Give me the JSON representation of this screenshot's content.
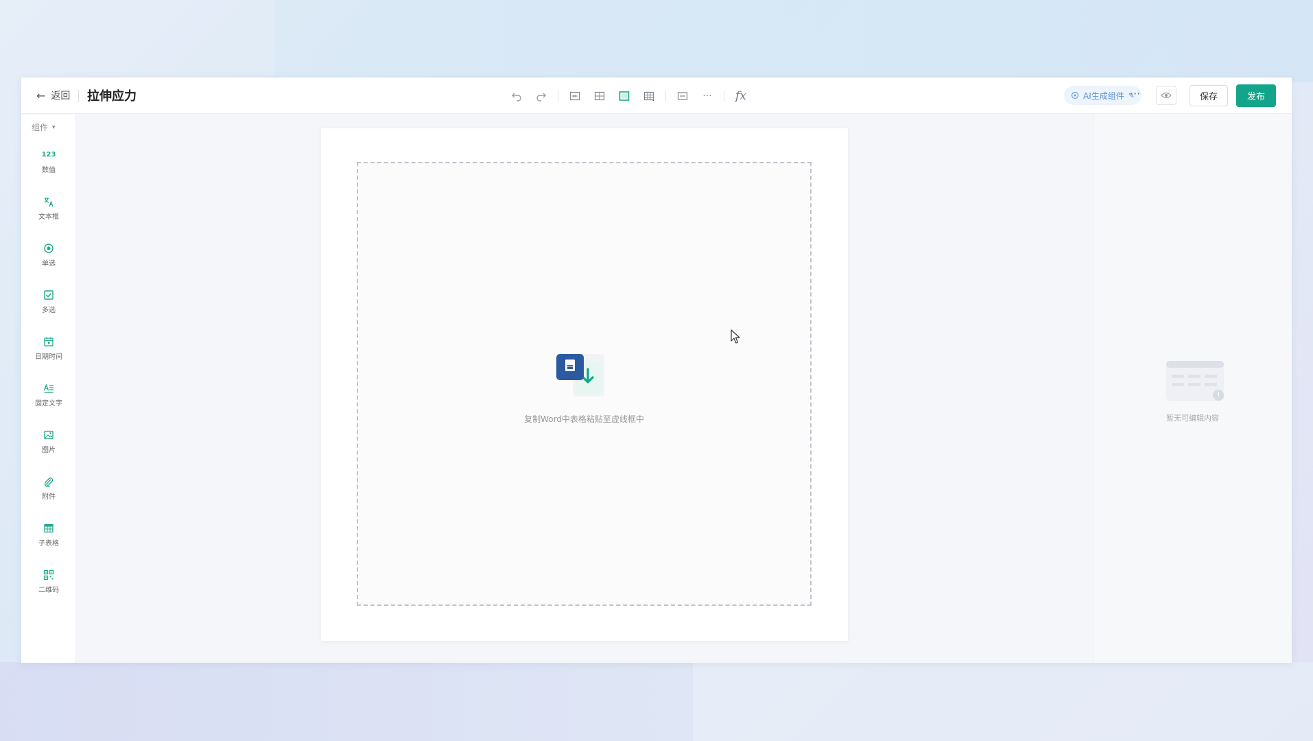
{
  "header": {
    "back_label": "返回",
    "title": "拉伸应力",
    "ai_label": "AI生成组件",
    "more_label": "···",
    "save_label": "保存",
    "publish_label": "发布",
    "fx_label": "fx"
  },
  "palette": {
    "title": "组件",
    "items": [
      {
        "label": "数值",
        "icon": "number-icon",
        "glyph": "123"
      },
      {
        "label": "文本框",
        "icon": "text-translate-icon"
      },
      {
        "label": "单选",
        "icon": "radio-icon"
      },
      {
        "label": "多选",
        "icon": "checkbox-icon"
      },
      {
        "label": "日期时间",
        "icon": "calendar-icon"
      },
      {
        "label": "固定文字",
        "icon": "fixed-text-icon"
      },
      {
        "label": "图片",
        "icon": "image-icon"
      },
      {
        "label": "附件",
        "icon": "paperclip-icon"
      },
      {
        "label": "子表格",
        "icon": "subtable-icon"
      },
      {
        "label": "二维码",
        "icon": "qrcode-icon"
      }
    ]
  },
  "canvas": {
    "drop_hint": "复制Word中表格粘贴至虚线框中"
  },
  "right_panel": {
    "empty_text": "暂无可编辑内容"
  },
  "colors": {
    "accent": "#13a58a",
    "icon_teal": "#1aa888",
    "word_blue": "#2c5aa0"
  }
}
